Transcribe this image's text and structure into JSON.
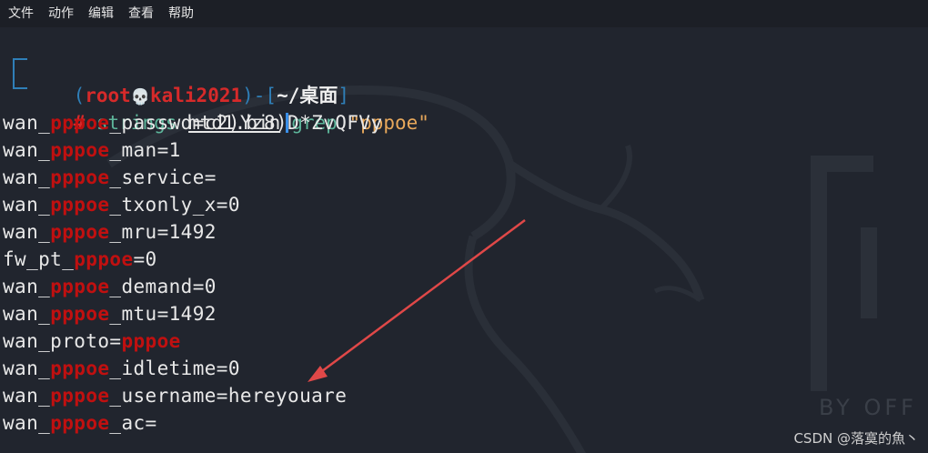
{
  "menubar": {
    "items": [
      "文件",
      "动作",
      "编辑",
      "查看",
      "帮助"
    ]
  },
  "prompt": {
    "open_paren": "(",
    "user": "root",
    "skull": "💀",
    "host": "kali2021",
    "close_paren": ")-[",
    "path": "~/桌面",
    "close_bracket": "]",
    "hash": "#",
    "command": "strings",
    "argument": "mtd1.bin",
    "pipe_cmd": "grep",
    "pattern": "\"pppoe\""
  },
  "output": [
    {
      "pre": "wan_",
      "match": "pppoe",
      "post": "_passwd=c2)Yz8)D*ZvQFVy"
    },
    {
      "pre": "wan_",
      "match": "pppoe",
      "post": "_man=1"
    },
    {
      "pre": "wan_",
      "match": "pppoe",
      "post": "_service="
    },
    {
      "pre": "wan_",
      "match": "pppoe",
      "post": "_txonly_x=0"
    },
    {
      "pre": "wan_",
      "match": "pppoe",
      "post": "_mru=1492"
    },
    {
      "pre": "fw_pt_",
      "match": "pppoe",
      "post": "=0"
    },
    {
      "pre": "wan_",
      "match": "pppoe",
      "post": "_demand=0"
    },
    {
      "pre": "wan_",
      "match": "pppoe",
      "post": "_mtu=1492"
    },
    {
      "pre": "wan_proto=",
      "match": "pppoe",
      "post": ""
    },
    {
      "pre": "wan_",
      "match": "pppoe",
      "post": "_idletime=0"
    },
    {
      "pre": "wan_",
      "match": "pppoe",
      "post": "_username=hereyouare"
    },
    {
      "pre": "wan_",
      "match": "pppoe",
      "post": "_ac="
    }
  ],
  "background": {
    "brand_text": "BY OFF"
  },
  "watermark": "CSDN @落寞的魚丶",
  "colors": {
    "background": "#21252e",
    "prompt_blue": "#2f7fb8",
    "highlight_red": "#c01010",
    "command_green": "#5db59a",
    "string_orange": "#e8a85b",
    "arrow_red": "#e04848"
  }
}
